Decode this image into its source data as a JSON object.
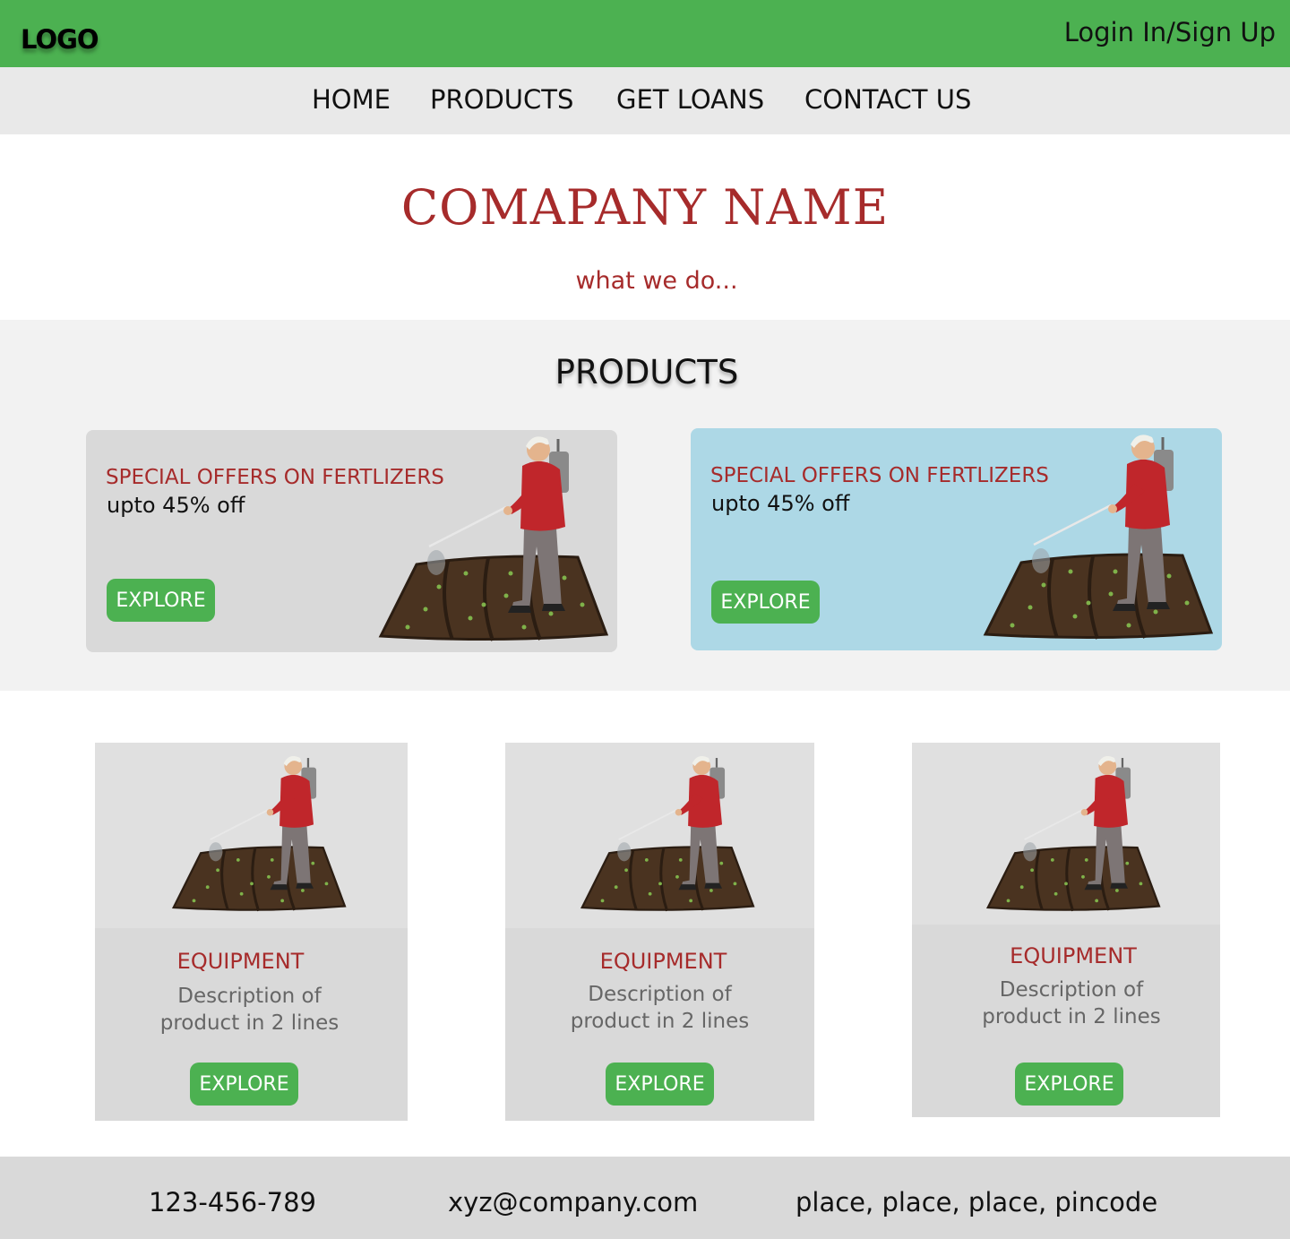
{
  "header": {
    "logo": "LOGO",
    "login": "Login In/Sign Up"
  },
  "nav": {
    "items": [
      "HOME",
      "PRODUCTS",
      "GET LOANS",
      "CONTACT US"
    ]
  },
  "hero": {
    "company_name": "COMAPANY NAME",
    "tagline": "what we do..."
  },
  "products": {
    "heading": "PRODUCTS",
    "offers": [
      {
        "title": "SPECIAL OFFERS ON FERTLIZERS",
        "subtitle": "upto 45% off",
        "button": "EXPLORE",
        "background": "#d9d9d9"
      },
      {
        "title": "SPECIAL OFFERS ON FERTLIZERS",
        "subtitle": "upto 45% off",
        "button": "EXPLORE",
        "background": "#add8e6"
      }
    ]
  },
  "cards": [
    {
      "title": "EQUIPMENT",
      "description": "Description of product in 2 lines",
      "button": "EXPLORE"
    },
    {
      "title": "EQUIPMENT",
      "description": "Description of product in 2 lines",
      "button": "EXPLORE"
    },
    {
      "title": "EQUIPMENT",
      "description": "Description of product in 2 lines",
      "button": "EXPLORE"
    }
  ],
  "footer": {
    "phone": "123-456-789",
    "email": "xyz@company.com",
    "address": "place, place, place, pincode"
  },
  "colors": {
    "primary_green": "#4cb151",
    "accent_red": "#a62b2b",
    "nav_bg": "#e9e9e9",
    "card_bg": "#d9d9d9",
    "offer_blue": "#add8e6"
  },
  "icons": {
    "product_illustration": "farmer-spraying-field-illustration"
  }
}
